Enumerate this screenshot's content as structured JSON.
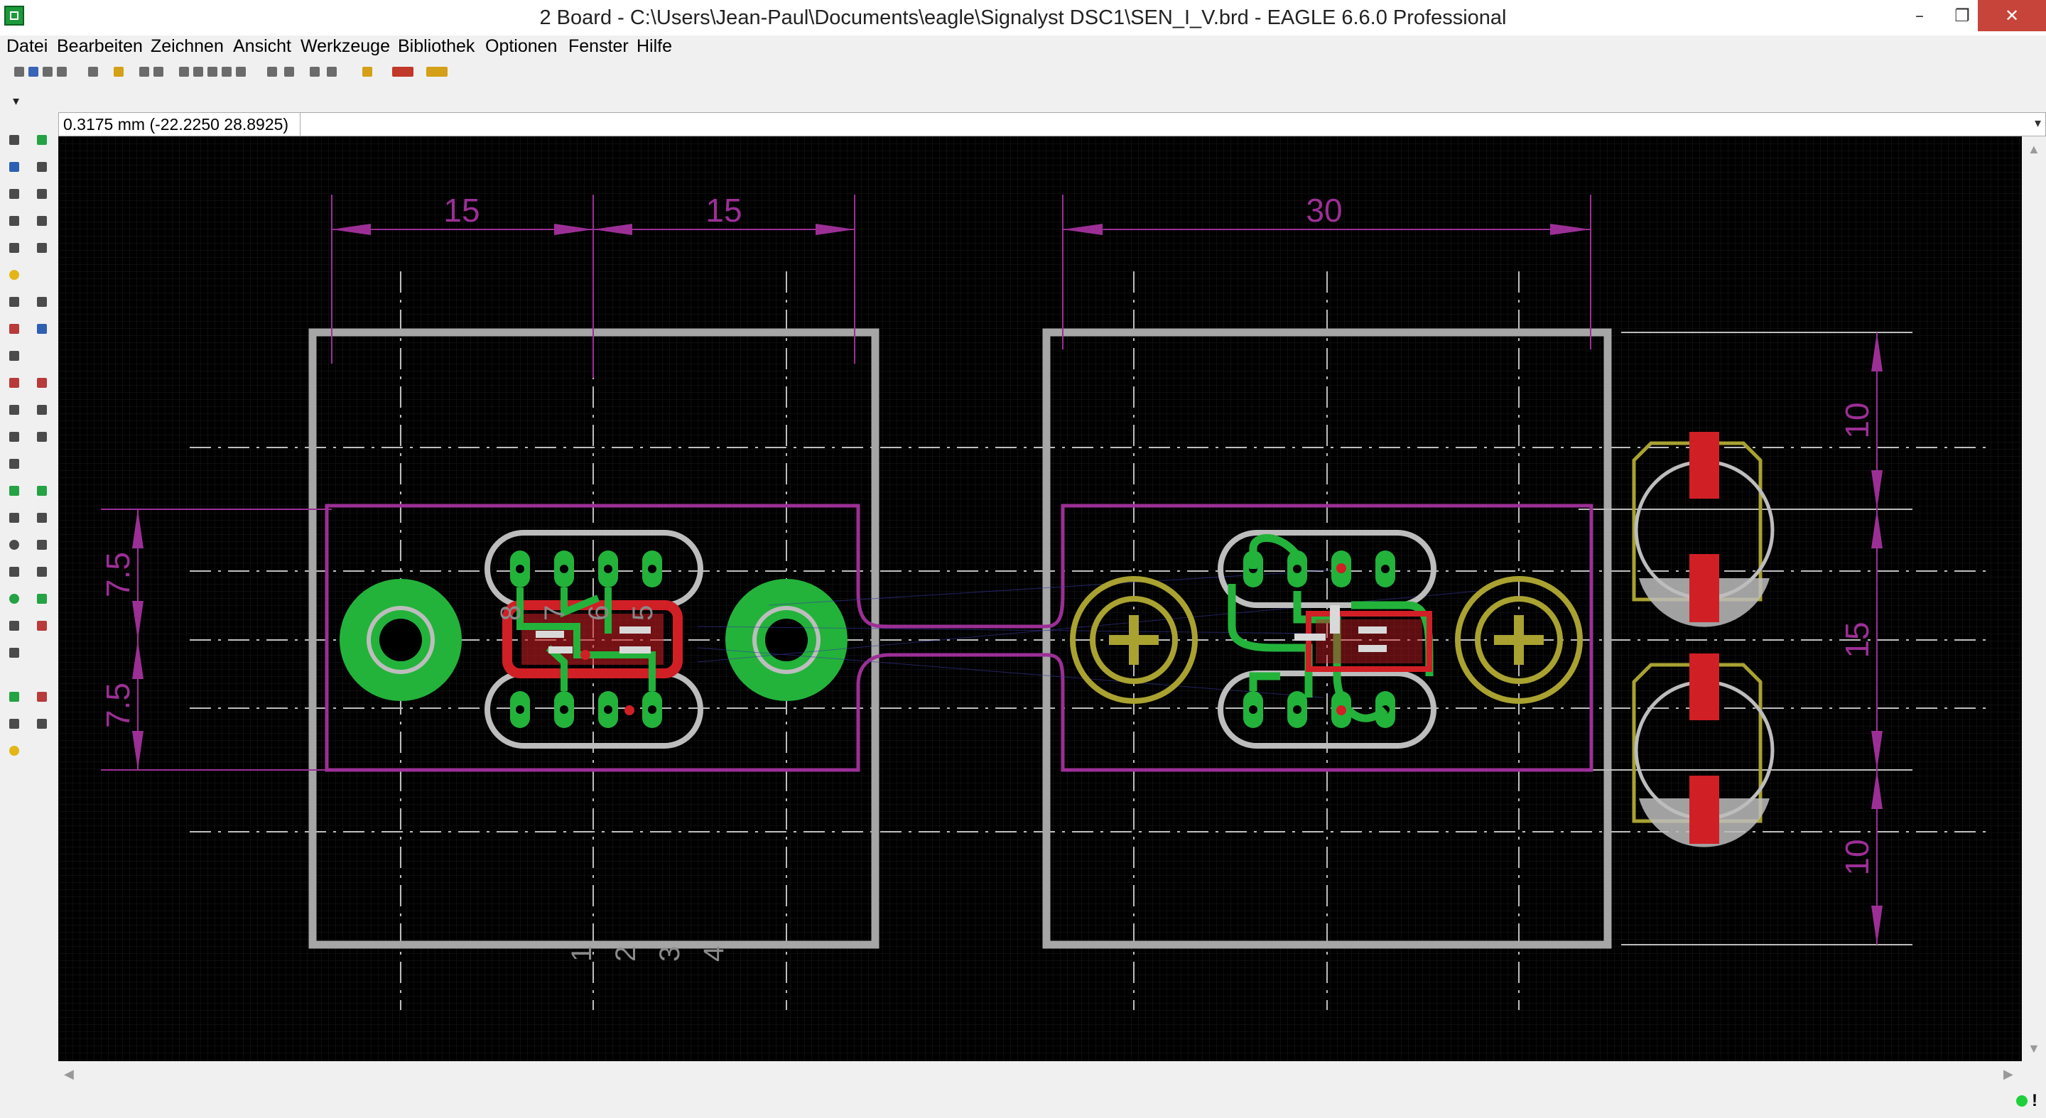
{
  "window": {
    "title": "2 Board - C:\\Users\\Jean-Paul\\Documents\\eagle\\Signalyst DSC1\\SEN_I_V.brd - EAGLE 6.6.0 Professional",
    "controls": {
      "minimize": "–",
      "maximize": "❐",
      "close": "✕"
    }
  },
  "menu": {
    "items": [
      "Datei",
      "Bearbeiten",
      "Zeichnen",
      "Ansicht",
      "Werkzeuge",
      "Bibliothek",
      "Optionen",
      "Fenster",
      "Hilfe"
    ]
  },
  "coordbar": {
    "readout": "0.3175 mm (-22.2250 28.8925)",
    "command": ""
  },
  "board": {
    "dimensions": {
      "left_pitch_a": "15",
      "left_pitch_b": "15",
      "right_span": "30",
      "left_half_top": "7.5",
      "left_half_bottom": "7.5",
      "right_top": "10",
      "right_mid": "15",
      "right_bottom": "10"
    },
    "pin_labels_top": [
      "8",
      "7",
      "6",
      "5"
    ],
    "pin_labels_bottom": [
      "1",
      "2",
      "3",
      "4"
    ]
  },
  "colors": {
    "canvas_background": "#000000",
    "outline_gray": "#a6a6a6",
    "dimension_purple": "#9c2f96",
    "copper_green": "#23b33b",
    "copper_red": "#d11f26",
    "via_yellow": "#a9a231",
    "pad_white": "#d9d9d9"
  },
  "status": {
    "indicator": "ready",
    "warning_mark": "!"
  }
}
